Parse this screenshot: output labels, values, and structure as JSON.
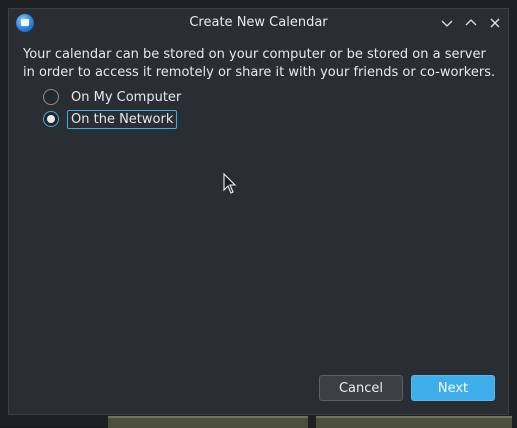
{
  "window": {
    "title": "Create New Calendar"
  },
  "titlebar": {
    "app_icon": "calendar-app-icon",
    "minimize_icon": "chevron-down-icon",
    "maximize_icon": "chevron-up-icon",
    "close_icon": "close-icon"
  },
  "content": {
    "description": "Your calendar can be stored on your computer or be stored on a server in order to access it remotely or share it with your friends or co-workers."
  },
  "options": {
    "selected": "On the Network",
    "items": [
      {
        "label": "On My Computer",
        "checked": false
      },
      {
        "label": "On the Network",
        "checked": true
      }
    ]
  },
  "buttons": {
    "cancel_label": "Cancel",
    "next_label": "Next"
  },
  "colors": {
    "accent": "#3daee9",
    "window_bg": "#2a2e32",
    "text": "#e6e8ea"
  }
}
